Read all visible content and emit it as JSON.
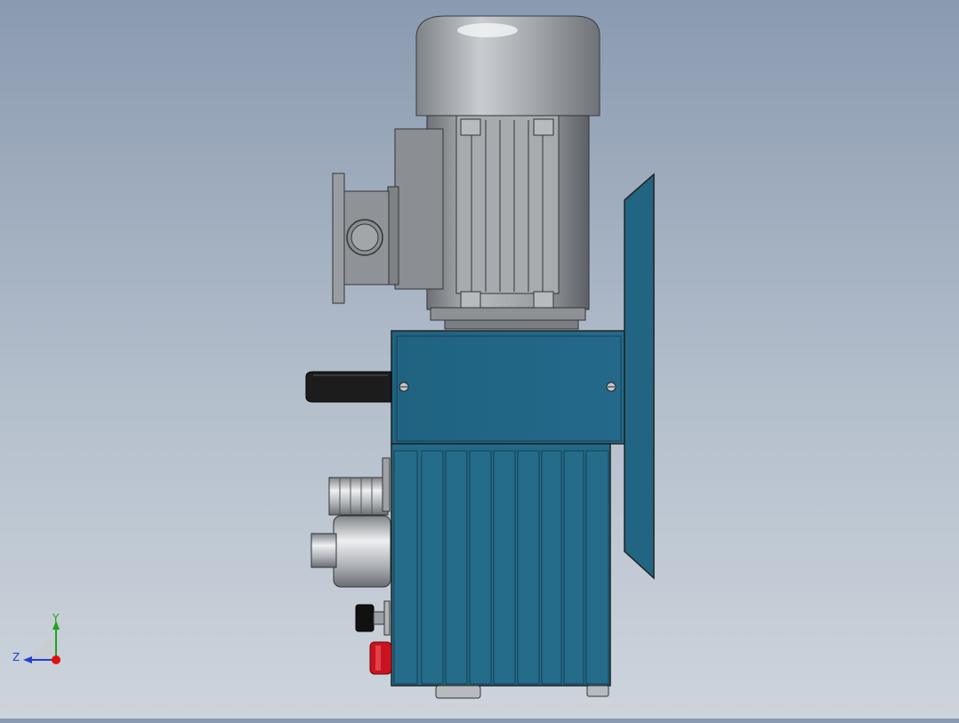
{
  "viewport": {
    "background_top": "#8a9ab0",
    "background_bottom": "#cdd4dc",
    "model": {
      "motor_color": "#9ea3a8",
      "housing_color": "#236a86",
      "handle_color": "#1a1a1a",
      "emergency_button_color": "#c8141e",
      "knob_color": "#111111"
    }
  },
  "triad": {
    "y_label": "Y",
    "z_label": "Z",
    "y_color": "#1fa31f",
    "z_color": "#1f3fd1",
    "x_color": "#e01010"
  }
}
